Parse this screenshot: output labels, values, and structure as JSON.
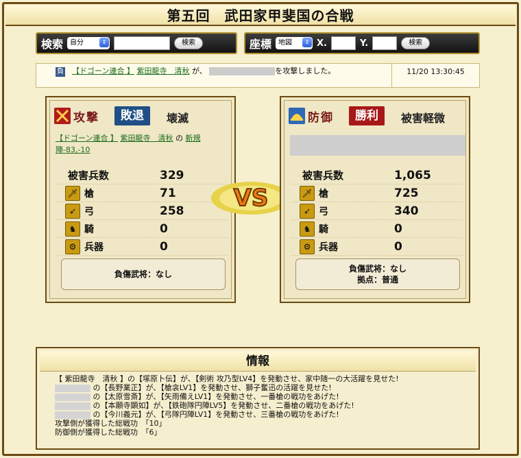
{
  "page": {
    "title": "第五回　武田家甲斐国の合戦"
  },
  "search": {
    "label": "検索",
    "select": "自分",
    "button": "検索"
  },
  "coords": {
    "label": "座標",
    "select": "地図",
    "x_label": "X.",
    "y_label": "Y.",
    "button": "検索"
  },
  "message": {
    "badge": "負",
    "alliance": "【ドゴーン連合 】",
    "player": "紫田龍寺　清秋",
    "mid": "が、",
    "tail": "を攻撃しました。",
    "time": "11/20 13:30:45"
  },
  "attack": {
    "role": "攻撃",
    "result": "敗退",
    "damage": "壊滅",
    "alliance": "【ドゴーン連合 】",
    "player": "紫田龍寺　清秋",
    "location_sep": "の",
    "location": "新規陣-83,-10",
    "total_label": "被害兵数",
    "total": "329",
    "rows": [
      {
        "label": "槍",
        "value": "71"
      },
      {
        "label": "弓",
        "value": "258"
      },
      {
        "label": "騎",
        "value": "0"
      },
      {
        "label": "兵器",
        "value": "0"
      }
    ],
    "wounded": "負傷武将：なし"
  },
  "defense": {
    "role": "防御",
    "result": "勝利",
    "damage": "被害軽微",
    "total_label": "被害兵数",
    "total": "1,065",
    "rows": [
      {
        "label": "槍",
        "value": "725"
      },
      {
        "label": "弓",
        "value": "340"
      },
      {
        "label": "騎",
        "value": "0"
      },
      {
        "label": "兵器",
        "value": "0"
      }
    ],
    "wounded": "負傷武将：なし",
    "base": "拠点：普通"
  },
  "vs": "VS",
  "info": {
    "title": "情報",
    "lines": [
      "【 紫田龍寺　清秋 】の【塚原卜伝】が、【剣術 攻乃型LV4】を発動させ、家中随一の大活躍を見せた!",
      "の【長野業正】が、【槍衾LV1】を発動させ、獅子奮迅の活躍を見せた!",
      "の【太原雪斎】が、【矢雨備えLV1】を発動させ、一番槍の戦功をあげた!",
      "の【本願寺顕如】が、【鉄砲隊円陣LV5】を発動させ、二番槍の戦功をあげた!",
      "の【今川義元】が、【弓隊円陣LV1】を発動させ、三番槍の戦功をあげた!",
      "攻撃側が獲得した総戦功　「10」",
      "防御側が獲得した総戦功　「6」"
    ]
  },
  "colors": {
    "lose": "#1f4f86",
    "win": "#a81818",
    "frame": "#6b4a13",
    "bg": "#f6f0cf"
  }
}
